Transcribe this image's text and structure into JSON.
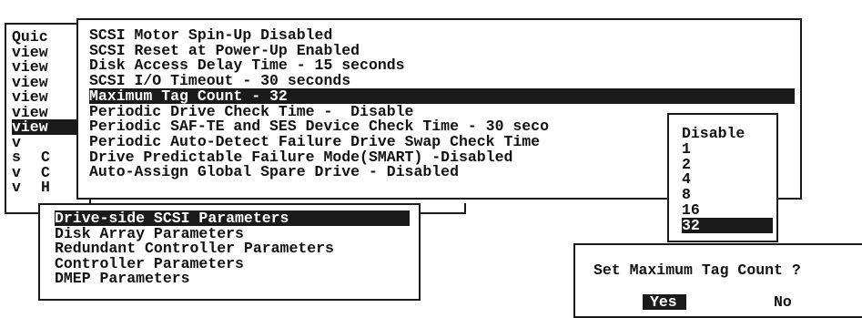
{
  "left_menu": {
    "items": [
      "Quic",
      "view",
      "view",
      "view",
      "view",
      "view",
      "view",
      "v",
      "s",
      "v",
      "v"
    ],
    "selected_index": 6,
    "col2": [
      "",
      "",
      "",
      "",
      "",
      "",
      "",
      "",
      "C",
      "C",
      "H"
    ]
  },
  "param_menu": {
    "items": [
      "SCSI Motor Spin-Up Disabled",
      "SCSI Reset at Power-Up Enabled",
      "Disk Access Delay Time - 15 seconds",
      "SCSI I/O Timeout - 30 seconds",
      "Maximum Tag Count - 32",
      "Periodic Drive Check Time -  Disable",
      "Periodic SAF-TE and SES Device Check Time - 30 seco",
      "Periodic Auto-Detect Failure Drive Swap Check Time",
      "Drive Predictable Failure Mode(SMART) -Disabled",
      "Auto-Assign Global Spare Drive - Disabled"
    ],
    "selected_index": 4
  },
  "config_menu": {
    "items": [
      "Drive-side SCSI Parameters",
      "Disk Array Parameters",
      "Redundant Controller Parameters",
      "Controller Parameters",
      "DMEP Parameters"
    ],
    "selected_index": 0
  },
  "tag_options": {
    "items": [
      "Disable",
      "1",
      "2",
      "4",
      "8",
      "16",
      "32"
    ],
    "selected_index": 6
  },
  "confirm_dialog": {
    "question": "Set Maximum Tag Count ?",
    "yes_label": "Yes",
    "no_label": "No"
  }
}
